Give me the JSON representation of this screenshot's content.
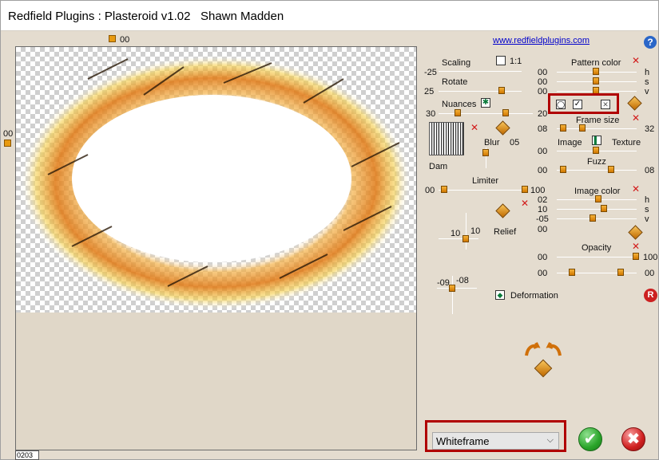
{
  "window": {
    "title": "Redfield Plugins : Plasteroid v1.02   Shawn Madden"
  },
  "header": {
    "link": "www.redfieldplugins.com",
    "help_glyph": "?"
  },
  "canvas": {
    "top_value": "00",
    "left_value": "00",
    "status_value": "0203"
  },
  "left_panel": {
    "scaling": {
      "label": "Scaling",
      "value": "-25",
      "check_label": "1:1"
    },
    "rotate": {
      "label": "Rotate",
      "value": "25"
    },
    "nuances": {
      "label": "Nuances",
      "value_left": "30",
      "value_right": "20"
    },
    "blur": {
      "label": "Blur",
      "value": "05"
    },
    "texture_label": "Dam",
    "limiter": {
      "label": "Limiter",
      "value_left": "00",
      "value_right": "100"
    },
    "relief": {
      "label": "Relief",
      "x": "10",
      "y": "10"
    },
    "deform_pad": {
      "x": "-09",
      "y": "-08"
    },
    "deformation": {
      "label": "Deformation"
    }
  },
  "right_panel": {
    "pattern_color": {
      "label": "Pattern color",
      "h": "00",
      "s": "00",
      "v": "00",
      "h_label": "h",
      "s_label": "s",
      "v_label": "v"
    },
    "frame_size": {
      "label": "Frame size",
      "value_left": "08",
      "value_right": "32"
    },
    "image_texture": {
      "image_label": "Image",
      "texture_label": "Texture",
      "value": "00"
    },
    "fuzz": {
      "label": "Fuzz",
      "value_left": "00",
      "value_right": "08"
    },
    "image_color": {
      "label": "Image color",
      "h": "02",
      "s": "10",
      "v": "-05",
      "extra": "00",
      "h_label": "h",
      "s_label": "s",
      "v_label": "v"
    },
    "opacity": {
      "label": "Opacity",
      "value_left": "00",
      "value_right": "100",
      "row2_left": "00",
      "row2_right": "00"
    },
    "reset_label": "R"
  },
  "footer": {
    "preset": "Whiteframe",
    "ok_glyph": "✔",
    "cancel_glyph": "✖"
  },
  "colors": {
    "accent": "#e89a10",
    "highlight_box": "#b00000",
    "ok": "#2aa52a",
    "cancel": "#d02020"
  }
}
